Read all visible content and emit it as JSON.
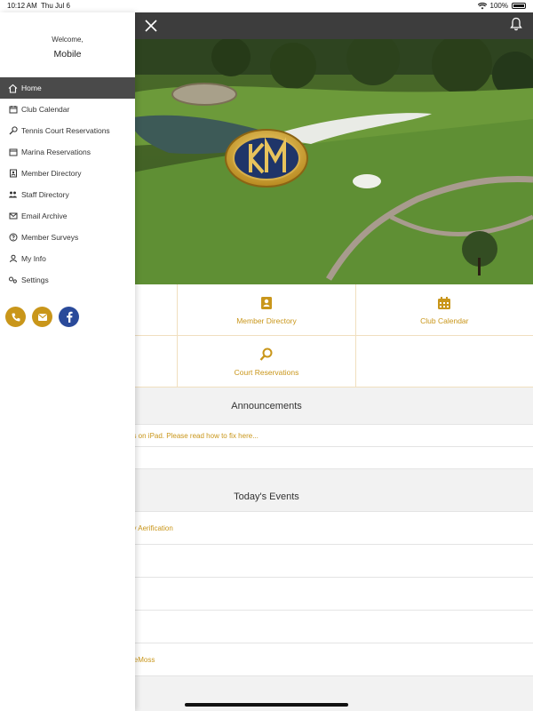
{
  "status": {
    "time": "10:12 AM",
    "date": "Thu Jul 6",
    "battery": "100%"
  },
  "drawer": {
    "welcome": "Welcome,",
    "user": "Mobile",
    "items": [
      {
        "label": "Home",
        "icon": "home-icon"
      },
      {
        "label": "Club Calendar",
        "icon": "calendar-icon"
      },
      {
        "label": "Tennis Court Reservations",
        "icon": "racquet-icon"
      },
      {
        "label": "Marina Reservations",
        "icon": "anchor-icon"
      },
      {
        "label": "Member Directory",
        "icon": "address-book-icon"
      },
      {
        "label": "Staff Directory",
        "icon": "users-icon"
      },
      {
        "label": "Email Archive",
        "icon": "envelope-icon"
      },
      {
        "label": "Member Surveys",
        "icon": "question-icon"
      },
      {
        "label": "My Info",
        "icon": "user-icon"
      },
      {
        "label": "Settings",
        "icon": "gear-icon"
      }
    ],
    "socials": [
      "phone-icon",
      "envelope-icon",
      "facebook-icon"
    ]
  },
  "tiles": {
    "member_directory": "Member Directory",
    "club_calendar": "Club Calendar",
    "court_reservations": "Court Reservations"
  },
  "announcements": {
    "title": "Announcements",
    "item": "ns on iPad. Please read how to fix here..."
  },
  "events": {
    "title": "Today's Events",
    "items": [
      "ay Aerification",
      "",
      "",
      "",
      "DeMoss"
    ]
  },
  "colors": {
    "accent": "#c9961a",
    "header": "#3d3d3d",
    "active_menu": "#4a4a4a",
    "facebook": "#2a4a9a"
  }
}
